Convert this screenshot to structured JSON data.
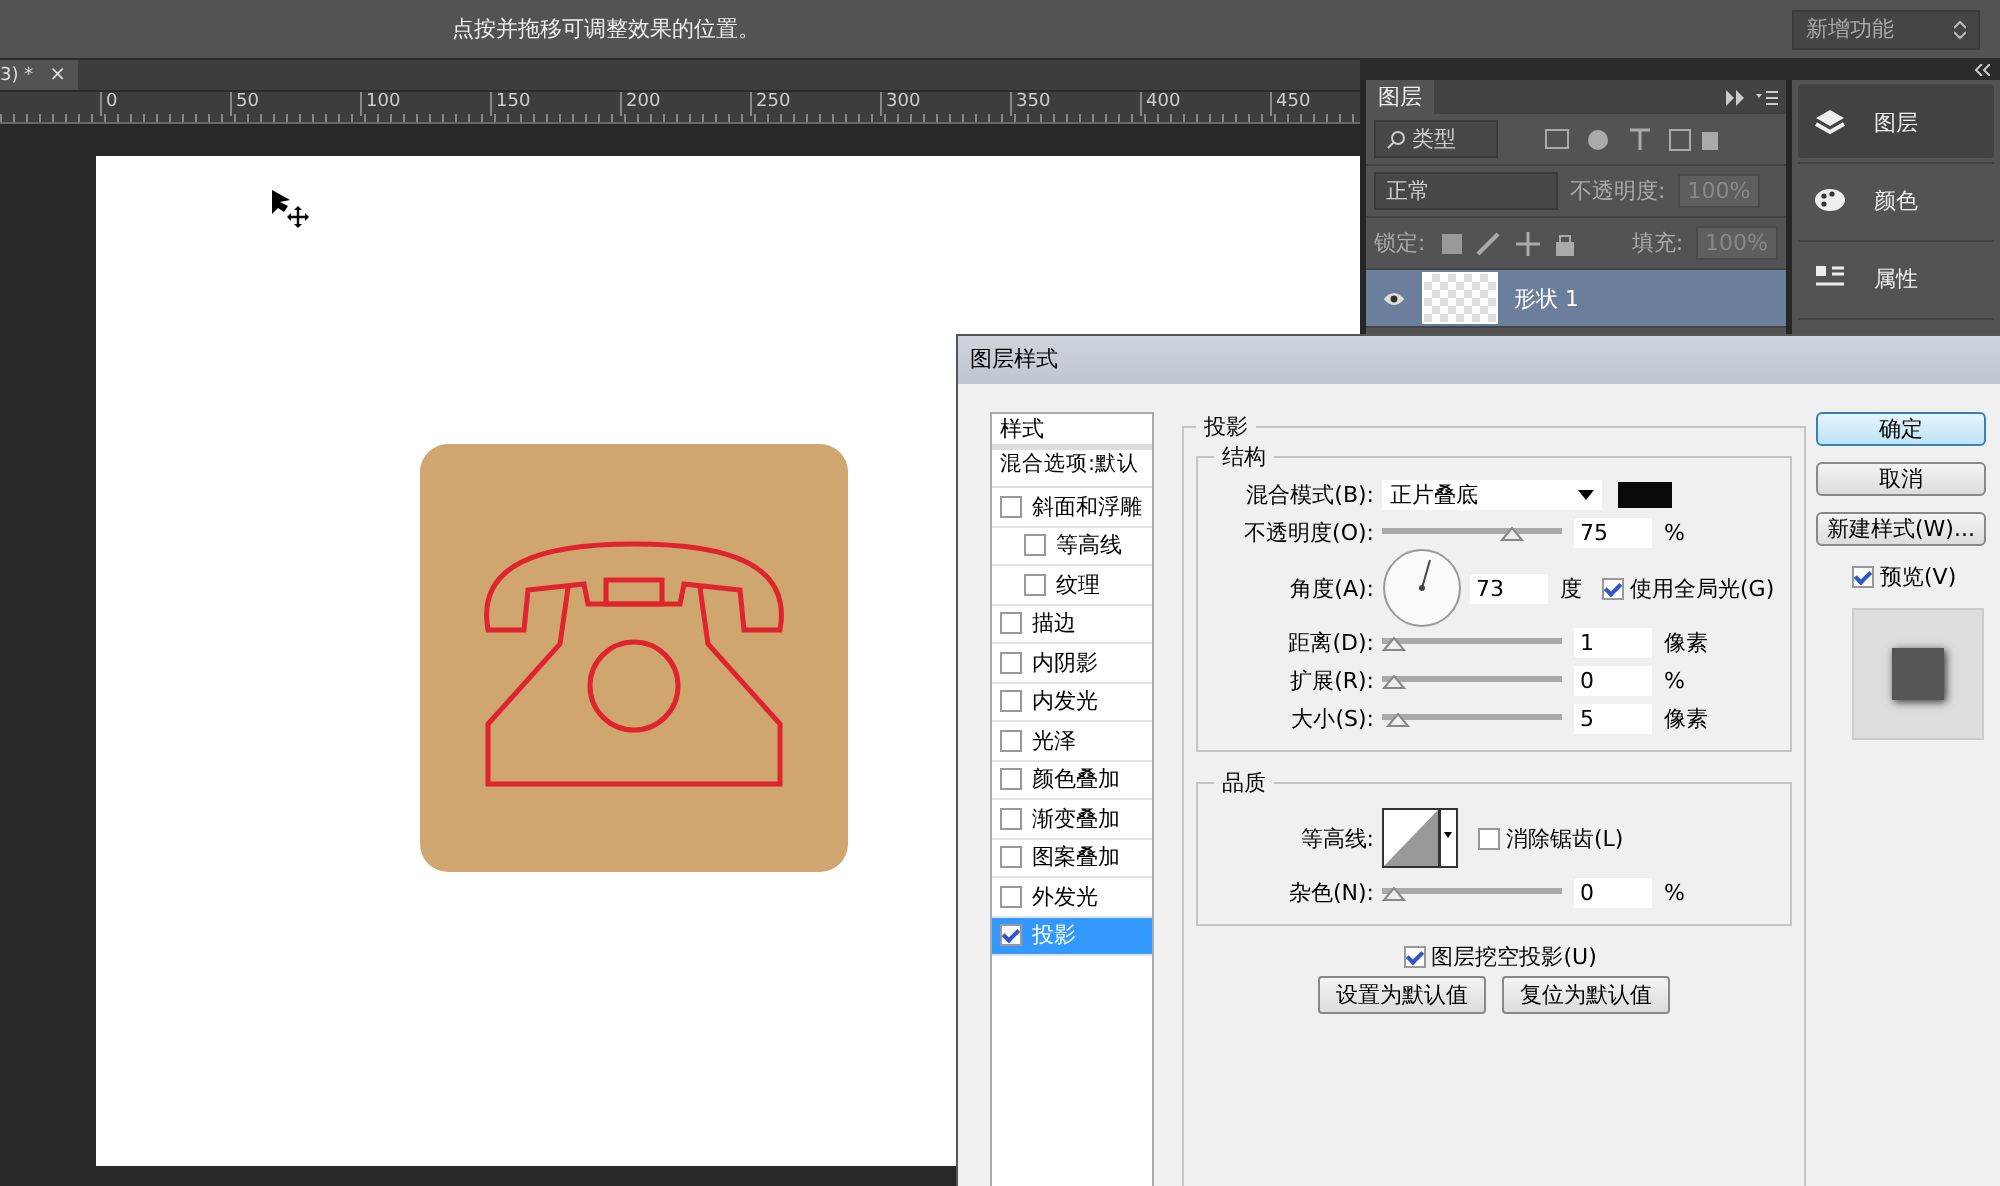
{
  "options_bar": {
    "hint": "点按并拖移可调整效果的位置。",
    "workspace": "新增功能"
  },
  "document_tab": {
    "title": "3) *",
    "close": "×"
  },
  "ruler": {
    "ticks": [
      "0",
      "50",
      "100",
      "150",
      "200",
      "250",
      "300",
      "350",
      "400",
      "450"
    ]
  },
  "layers_panel": {
    "tab": "图层",
    "filter": "类型",
    "blend_mode": "正常",
    "opacity_label": "不透明度:",
    "opacity": "100%",
    "lock_label": "锁定:",
    "fill_label": "填充:",
    "fill": "100%",
    "layers": [
      {
        "name": "形状 1",
        "visible": true,
        "selected": true
      }
    ]
  },
  "dock": {
    "items": [
      {
        "label": "图层",
        "selected": true
      },
      {
        "label": "颜色",
        "selected": false
      },
      {
        "label": "属性",
        "selected": false
      }
    ]
  },
  "dialog": {
    "title": "图层样式",
    "styles_header": "样式",
    "blend_options": "混合选项:默认",
    "styles": [
      {
        "label": "斜面和浮雕",
        "checked": false,
        "selected": false,
        "children": [
          {
            "label": "等高线",
            "checked": false,
            "selected": false
          },
          {
            "label": "纹理",
            "checked": false,
            "selected": false
          }
        ]
      },
      {
        "label": "描边",
        "checked": false,
        "selected": false
      },
      {
        "label": "内阴影",
        "checked": false,
        "selected": false
      },
      {
        "label": "内发光",
        "checked": false,
        "selected": false
      },
      {
        "label": "光泽",
        "checked": false,
        "selected": false
      },
      {
        "label": "颜色叠加",
        "checked": false,
        "selected": false
      },
      {
        "label": "渐变叠加",
        "checked": false,
        "selected": false
      },
      {
        "label": "图案叠加",
        "checked": false,
        "selected": false
      },
      {
        "label": "外发光",
        "checked": false,
        "selected": false
      },
      {
        "label": "投影",
        "checked": true,
        "selected": true
      }
    ],
    "section": "投影",
    "structure": "结构",
    "structure_rows": [
      {
        "kind": "select",
        "label": "混合模式(B):",
        "value": "正片叠底"
      },
      {
        "kind": "slider",
        "label": "不透明度(O):",
        "level": 0.75,
        "value": "75",
        "unit": "%"
      },
      {
        "kind": "angle",
        "label": "角度(A):",
        "value": "73",
        "unit": "度",
        "checkbox": {
          "label": "使用全局光(G)",
          "checked": true
        }
      },
      {
        "kind": "slider",
        "label": "距离(D):",
        "level": 0,
        "value": "1",
        "unit": "像素"
      },
      {
        "kind": "slider",
        "label": "扩展(R):",
        "level": 0,
        "value": "0",
        "unit": "%"
      },
      {
        "kind": "slider",
        "label": "大小(S):",
        "level": 0.03,
        "value": "5",
        "unit": "像素"
      }
    ],
    "quality": "品质",
    "quality_rows": [
      {
        "kind": "contour",
        "label": "等高线:",
        "checkbox": {
          "label": "消除锯齿(L)",
          "checked": false
        }
      },
      {
        "kind": "slider",
        "label": "杂色(N):",
        "level": 0,
        "value": "0",
        "unit": "%"
      }
    ],
    "knockout": {
      "label": "图层挖空投影(U)",
      "checked": true
    },
    "default_buttons": [
      "设置为默认值",
      "复位为默认值"
    ],
    "side_buttons": [
      {
        "label": "确定",
        "kind": "primary"
      },
      {
        "label": "取消",
        "kind": "normal"
      },
      {
        "label": "新建样式(W)...",
        "kind": "normal"
      }
    ],
    "preview": {
      "label": "预览(V)",
      "checked": true
    }
  }
}
